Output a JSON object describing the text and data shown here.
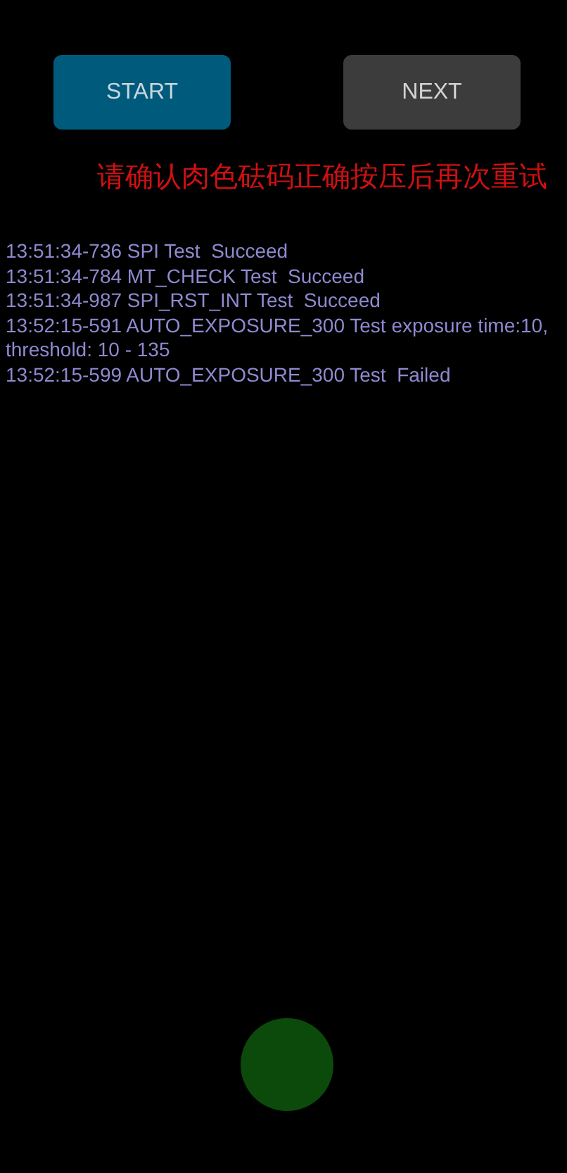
{
  "buttons": [
    {
      "label": "START",
      "kind": "primary"
    },
    {
      "label": "NEXT",
      "kind": "secondary"
    }
  ],
  "message": "请确认肉色砝码正确按压后再次重试",
  "log": [
    "13:51:34-736 SPI Test  Succeed",
    "13:51:34-784 MT_CHECK Test  Succeed",
    "13:51:34-987 SPI_RST_INT Test  Succeed",
    "13:52:15-591 AUTO_EXPOSURE_300 Test exposure time:10, threshold: 10 - 135",
    "13:52:15-599 AUTO_EXPOSURE_300 Test  Failed"
  ]
}
